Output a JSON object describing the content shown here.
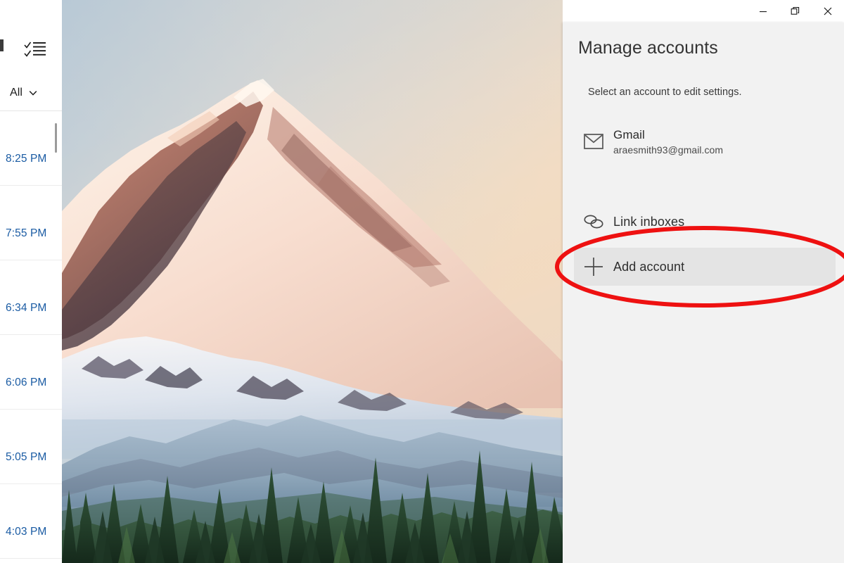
{
  "window": {
    "controls": [
      {
        "name": "minimize",
        "glyph": "minimize-icon",
        "label": "Minimize"
      },
      {
        "name": "restore",
        "glyph": "restore-icon",
        "label": "Restore"
      },
      {
        "name": "close",
        "glyph": "close-icon",
        "label": "Close"
      }
    ],
    "titlebar_color": "#c3cfd8"
  },
  "mail_list": {
    "select_all_icon": "select-all-checklist-icon",
    "filter": {
      "label": "All",
      "chevron": "chevron-down-icon"
    },
    "messages": [
      {
        "time": "8:25 PM"
      },
      {
        "time": "7:55 PM"
      },
      {
        "time": "6:34 PM"
      },
      {
        "time": "6:06 PM"
      },
      {
        "time": "5:05 PM"
      },
      {
        "time": "4:03 PM"
      }
    ],
    "time_color": "#1a5ba3"
  },
  "flyout": {
    "title": "Manage accounts",
    "subtitle": "Select an account to edit settings.",
    "accounts": [
      {
        "icon": "envelope-icon",
        "name": "Gmail",
        "email": "araesmith93@gmail.com"
      }
    ],
    "options": [
      {
        "icon": "link-chain-icon",
        "label": "Link inboxes",
        "highlighted": false
      },
      {
        "icon": "plus-icon",
        "label": "Add account",
        "highlighted": true
      }
    ],
    "background_color": "#f2f2f2",
    "highlight_color": "#e4e4e4"
  },
  "annotation": {
    "shape": "ellipse",
    "color": "#ee1111",
    "target": "Add account"
  },
  "photo": {
    "description": "Mount Rainier at sunset with conifer forest",
    "sky_top_color": "#b9cad6",
    "sky_warm_color": "#f1d9c0",
    "forest_color": "#2d4a35"
  }
}
